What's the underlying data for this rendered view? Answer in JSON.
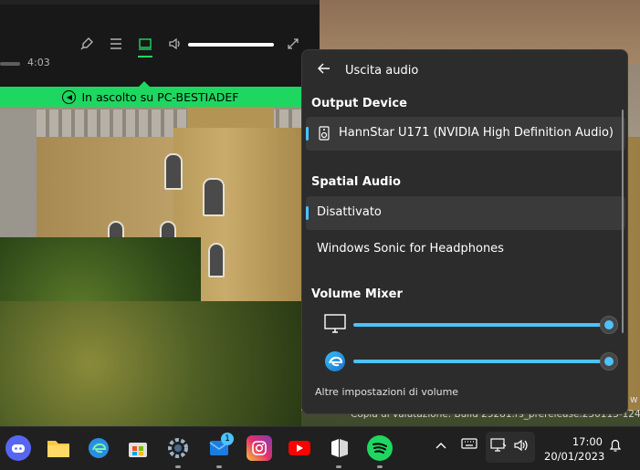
{
  "player": {
    "elapsed_time": "4:03",
    "listening_on_label": "In ascolto su PC-BESTIADEF",
    "volume_level": 1.0,
    "icons": [
      "microphone-icon",
      "queue-icon",
      "connect-device-icon",
      "volume-icon",
      "fullscreen-icon"
    ]
  },
  "flyout": {
    "title": "Uscita audio",
    "output_device_heading": "Output Device",
    "output_device": "HannStar U171 (NVIDIA High Definition Audio)",
    "spatial_audio_heading": "Spatial Audio",
    "spatial_options": [
      {
        "label": "Disattivato",
        "selected": true
      },
      {
        "label": "Windows Sonic for Headphones",
        "selected": false
      }
    ],
    "volume_mixer_heading": "Volume Mixer",
    "mixer": [
      {
        "app": "system-monitor-icon",
        "level": 1.0
      },
      {
        "app": "edge-icon",
        "level": 1.0
      }
    ],
    "more_settings": "Altre impostazioni di volume"
  },
  "watermark": {
    "text": "Copia di valutazione. Build 25281.rs_prerelease.230113-1248",
    "edge_char": "w"
  },
  "taskbar": {
    "apps": [
      {
        "name": "discord",
        "badge": ""
      },
      {
        "name": "file-explorer",
        "badge": ""
      },
      {
        "name": "edge",
        "badge": ""
      },
      {
        "name": "microsoft-store",
        "badge": ""
      },
      {
        "name": "settings",
        "badge": ""
      },
      {
        "name": "mail",
        "badge": "1"
      },
      {
        "name": "instagram",
        "badge": ""
      },
      {
        "name": "youtube",
        "badge": ""
      },
      {
        "name": "notion-like",
        "badge": ""
      },
      {
        "name": "spotify",
        "badge": ""
      }
    ],
    "time": "17:00",
    "date": "20/01/2023",
    "accent": "#4cc2ff",
    "spotify_green": "#1ed760"
  }
}
